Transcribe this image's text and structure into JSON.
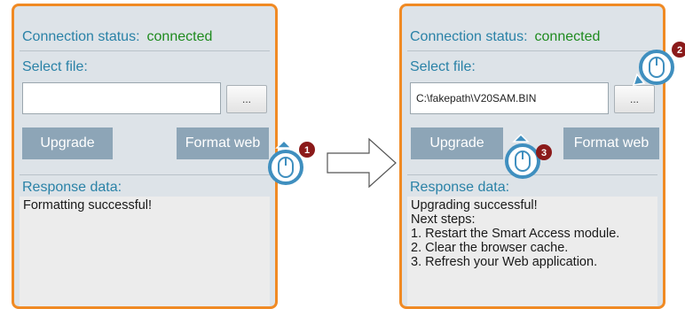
{
  "left_panel": {
    "connection_label": "Connection status:",
    "connection_value": "connected",
    "select_label": "Select file:",
    "file_value": "",
    "browse_label": "...",
    "upgrade_label": "Upgrade",
    "format_label": "Format web",
    "response_label": "Response data:",
    "response_lines": [
      "Formatting successful!"
    ]
  },
  "right_panel": {
    "connection_label": "Connection status:",
    "connection_value": "connected",
    "select_label": "Select file:",
    "file_value": "C:\\fakepath\\V20SAM.BIN",
    "browse_label": "...",
    "upgrade_label": "Upgrade",
    "format_label": "Format web",
    "response_label": "Response data:",
    "response_lines": [
      "Upgrading successful!",
      "Next steps:",
      "1. Restart the Smart Access module.",
      "2. Clear the browser cache.",
      "3. Refresh your Web application."
    ]
  },
  "steps": {
    "format_step": "1",
    "upgrade_step": "3",
    "browse_step": "2"
  },
  "colors": {
    "panel_border": "#f08a24",
    "panel_bg": "#dde3e8",
    "label_blue": "#2a82a7",
    "status_green": "#1f8b1f",
    "button_bg": "#8da5b7",
    "step_badge": "#8b1a1a",
    "pointer_blue": "#3f8fbf"
  }
}
